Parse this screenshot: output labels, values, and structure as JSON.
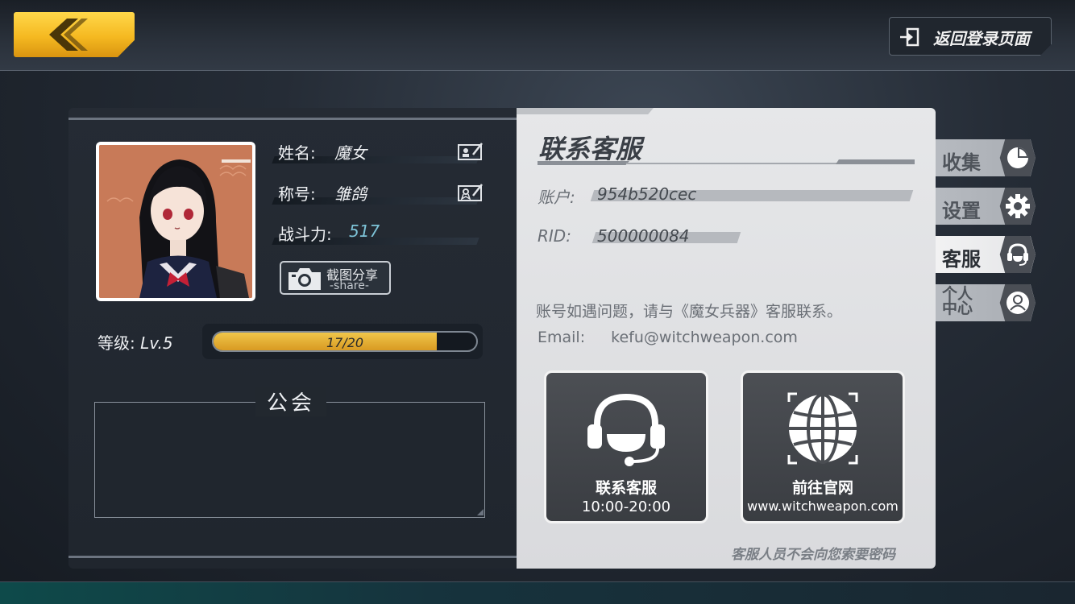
{
  "header": {
    "logout_label": "返回登录页面"
  },
  "profile": {
    "name_label": "姓名:",
    "name_value": "魔女",
    "title_label": "称号:",
    "title_value": "雏鸽",
    "power_label": "战斗力:",
    "power_value": "517",
    "share_label": "截图分享",
    "share_sub": "-share-",
    "level_label": "等级:",
    "level_value": "Lv.5",
    "xp_text": "17/20",
    "xp_current": 17,
    "xp_max": 20,
    "guild_title": "公会"
  },
  "support": {
    "title": "联系客服",
    "account_label": "账户:",
    "account_value": "954b520cec",
    "rid_label": "RID:",
    "rid_value": "500000084",
    "notice": "账号如遇问题，请与《魔女兵器》客服联系。",
    "email_label": "Email:",
    "email_value": "kefu@witchweapon.com",
    "card_service_title": "联系客服",
    "card_service_hours": "10:00-20:00",
    "card_site_title": "前往官网",
    "card_site_url": "www.witchweapon.com",
    "footer_note": "客服人员不会向您索要密码"
  },
  "side_tabs": [
    {
      "label": "收集",
      "icon": "pie-chart-icon",
      "active": false
    },
    {
      "label": "设置",
      "icon": "gear-icon",
      "active": false
    },
    {
      "label": "客服",
      "icon": "headset-icon",
      "active": true
    },
    {
      "label": "个人中心",
      "line1": "个人",
      "line2": "中心",
      "icon": "user-icon",
      "active": false
    }
  ],
  "colors": {
    "accent_gold": "#f5b921",
    "xp_fill": "#e0a82c",
    "power_value": "#7ec4d8",
    "panel_dark": "#22282f",
    "panel_light": "#e0e1e3"
  }
}
